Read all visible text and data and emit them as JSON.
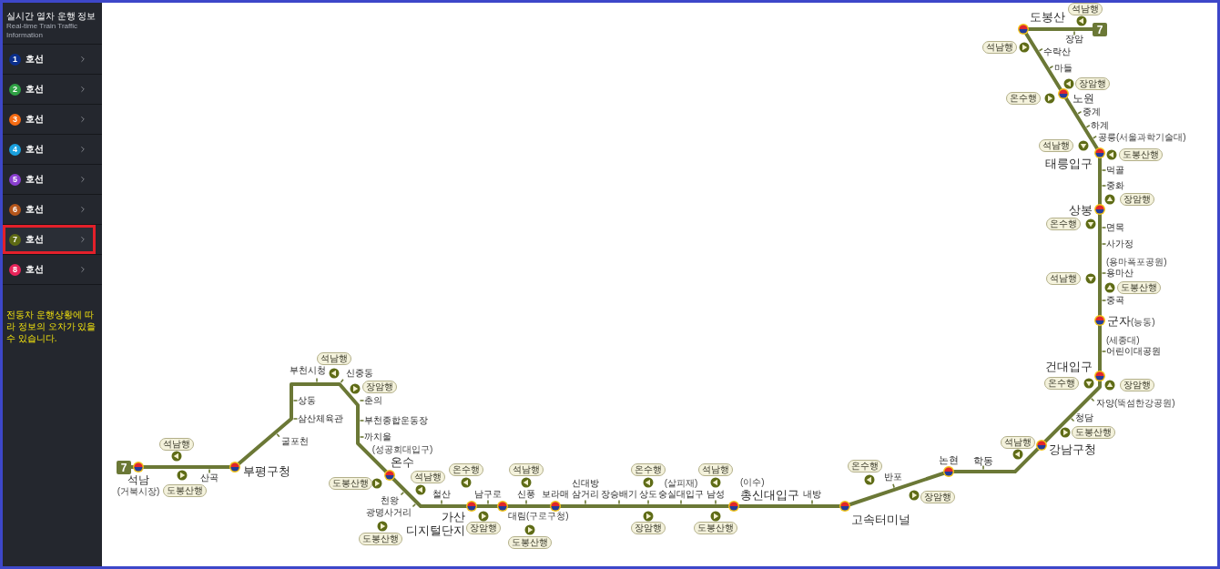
{
  "sidebar": {
    "title": "실시간 열차 운행 정보",
    "subtitle": "Real-time Train Traffic Information",
    "lines": [
      {
        "number": "1",
        "label": "호선",
        "color": "#0b2f8c",
        "selected": false
      },
      {
        "number": "2",
        "label": "호선",
        "color": "#2fa044",
        "selected": false
      },
      {
        "number": "3",
        "label": "호선",
        "color": "#f56b12",
        "selected": false
      },
      {
        "number": "4",
        "label": "호선",
        "color": "#1aa0de",
        "selected": false
      },
      {
        "number": "5",
        "label": "호선",
        "color": "#8a3fd0",
        "selected": false
      },
      {
        "number": "6",
        "label": "호선",
        "color": "#b5561b",
        "selected": false
      },
      {
        "number": "7",
        "label": "호선",
        "color": "#5e6a14",
        "selected": true
      },
      {
        "number": "8",
        "label": "호선",
        "color": "#e8245a",
        "selected": false
      }
    ],
    "notice": "전동차 운행상황에 따라 정보의 오차가 있을 수 있습니다."
  },
  "map": {
    "line_badges": [
      "7",
      "7"
    ],
    "stations": [
      {
        "name_lines": [
          "석남"
        ],
        "note": "(거북시장)",
        "kind": "transfer"
      },
      {
        "name_lines": [
          "산곡"
        ],
        "kind": "regular"
      },
      {
        "name_lines": [
          "부천시청"
        ],
        "kind": "regular"
      },
      {
        "name_lines": [
          "상동"
        ],
        "kind": "regular"
      },
      {
        "name_lines": [
          "삼산체육관"
        ],
        "kind": "regular"
      },
      {
        "name_lines": [
          "굴포천"
        ],
        "kind": "regular"
      },
      {
        "name_lines": [
          "부평구청"
        ],
        "kind": "transfer"
      },
      {
        "name_lines": [
          "신중동"
        ],
        "kind": "regular"
      },
      {
        "name_lines": [
          "춘의"
        ],
        "kind": "regular"
      },
      {
        "name_lines": [
          "부천종합운동장"
        ],
        "kind": "regular"
      },
      {
        "name_lines": [
          "까치울"
        ],
        "kind": "regular"
      },
      {
        "name_lines": [
          "온수"
        ],
        "note": "(성공회대입구)",
        "kind": "transfer"
      },
      {
        "name_lines": [
          "천왕"
        ],
        "kind": "regular"
      },
      {
        "name_lines": [
          "광명사거리"
        ],
        "kind": "regular"
      },
      {
        "name_lines": [
          "철산"
        ],
        "kind": "regular"
      },
      {
        "name_lines": [
          "가산",
          "디지털단지"
        ],
        "kind": "transfer"
      },
      {
        "name_lines": [
          "남구로"
        ],
        "kind": "regular"
      },
      {
        "name_lines": [
          "대림"
        ],
        "note": "(구로구청)",
        "kind": "transfer"
      },
      {
        "name_lines": [
          "신풍"
        ],
        "kind": "regular"
      },
      {
        "name_lines": [
          "보라매"
        ],
        "kind": "transfer"
      },
      {
        "name_lines": [
          "신대방",
          "삼거리"
        ],
        "kind": "regular"
      },
      {
        "name_lines": [
          "장승배기"
        ],
        "kind": "regular"
      },
      {
        "name_lines": [
          "상도"
        ],
        "kind": "regular"
      },
      {
        "name_lines": [
          "숭실대입구"
        ],
        "note": "(살피재)",
        "kind": "regular"
      },
      {
        "name_lines": [
          "남성"
        ],
        "kind": "regular"
      },
      {
        "name_lines": [
          "총신대입구"
        ],
        "note": "(이수)",
        "kind": "transfer"
      },
      {
        "name_lines": [
          "내방"
        ],
        "kind": "regular"
      },
      {
        "name_lines": [
          "반포"
        ],
        "kind": "regular"
      },
      {
        "name_lines": [
          "고속터미널"
        ],
        "kind": "transfer"
      },
      {
        "name_lines": [
          "논현"
        ],
        "kind": "transfer"
      },
      {
        "name_lines": [
          "학동"
        ],
        "kind": "regular"
      },
      {
        "name_lines": [
          "도봉산"
        ],
        "kind": "transfer"
      },
      {
        "name_lines": [
          "장암"
        ],
        "kind": "regular"
      },
      {
        "name_lines": [
          "수락산"
        ],
        "kind": "regular"
      },
      {
        "name_lines": [
          "마들"
        ],
        "kind": "regular"
      },
      {
        "name_lines": [
          "노원"
        ],
        "kind": "transfer"
      },
      {
        "name_lines": [
          "중계"
        ],
        "kind": "regular"
      },
      {
        "name_lines": [
          "하계"
        ],
        "kind": "regular"
      },
      {
        "name_lines": [
          "공릉"
        ],
        "note": "(서울과학기술대)",
        "kind": "regular"
      },
      {
        "name_lines": [
          "태릉입구"
        ],
        "kind": "transfer"
      },
      {
        "name_lines": [
          "먹골"
        ],
        "kind": "regular"
      },
      {
        "name_lines": [
          "중화"
        ],
        "kind": "regular"
      },
      {
        "name_lines": [
          "상봉"
        ],
        "kind": "transfer"
      },
      {
        "name_lines": [
          "면목"
        ],
        "kind": "regular"
      },
      {
        "name_lines": [
          "사가정"
        ],
        "kind": "regular"
      },
      {
        "name_lines": [
          "용마산"
        ],
        "note": "(용마폭포공원)",
        "kind": "regular"
      },
      {
        "name_lines": [
          "중곡"
        ],
        "kind": "regular"
      },
      {
        "name_lines": [
          "군자"
        ],
        "note": "(능동)",
        "kind": "transfer"
      },
      {
        "name_lines": [
          "어린이대공원"
        ],
        "note": "(세종대)",
        "kind": "regular"
      },
      {
        "name_lines": [
          "건대입구"
        ],
        "kind": "transfer"
      },
      {
        "name_lines": [
          "자양"
        ],
        "note": "(뚝섬한강공원)",
        "kind": "regular"
      },
      {
        "name_lines": [
          "청담"
        ],
        "kind": "regular"
      },
      {
        "name_lines": [
          "강남구청"
        ],
        "kind": "transfer"
      }
    ],
    "trains": [
      {
        "destination": "석남행",
        "kind": "left"
      },
      {
        "destination": "도봉산행",
        "kind": "right"
      },
      {
        "destination": "석남행",
        "kind": "left"
      },
      {
        "destination": "장암행",
        "kind": "right"
      },
      {
        "destination": "도봉산행",
        "kind": "right"
      },
      {
        "destination": "석남행",
        "kind": "left"
      },
      {
        "destination": "도봉산행",
        "kind": "right"
      },
      {
        "destination": "온수행",
        "kind": "left"
      },
      {
        "destination": "장암행",
        "kind": "right"
      },
      {
        "destination": "석남행",
        "kind": "left"
      },
      {
        "destination": "도봉산행",
        "kind": "right"
      },
      {
        "destination": "온수행",
        "kind": "left"
      },
      {
        "destination": "장암행",
        "kind": "right"
      },
      {
        "destination": "석남행",
        "kind": "left"
      },
      {
        "destination": "도봉산행",
        "kind": "right"
      },
      {
        "destination": "온수행",
        "kind": "left"
      },
      {
        "destination": "장암행",
        "kind": "right"
      },
      {
        "destination": "석남행",
        "kind": "left"
      },
      {
        "destination": "석남행",
        "kind": "right"
      },
      {
        "destination": "장암행",
        "kind": "left"
      },
      {
        "destination": "온수행",
        "kind": "right"
      },
      {
        "destination": "석남행",
        "kind": "down"
      },
      {
        "destination": "도봉산행",
        "kind": "left"
      },
      {
        "destination": "장암행",
        "kind": "up"
      },
      {
        "destination": "온수행",
        "kind": "down"
      },
      {
        "destination": "석남행",
        "kind": "down"
      },
      {
        "destination": "도봉산행",
        "kind": "up"
      },
      {
        "destination": "온수행",
        "kind": "down"
      },
      {
        "destination": "장암행",
        "kind": "up"
      },
      {
        "destination": "석남행",
        "kind": "left"
      },
      {
        "destination": "도봉산행",
        "kind": "right"
      }
    ]
  }
}
